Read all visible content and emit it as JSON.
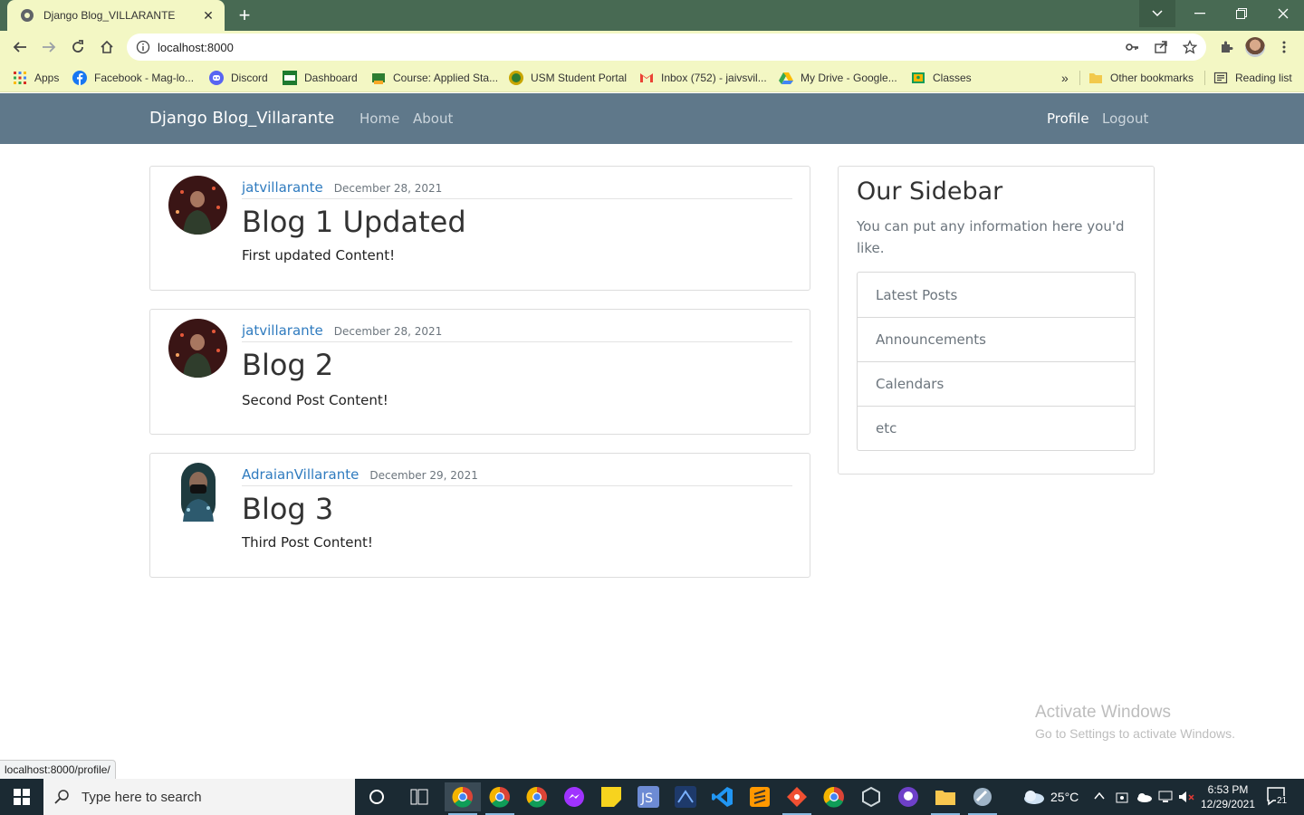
{
  "browser": {
    "tab_title": "Django Blog_VILLARANTE",
    "url": "localhost:8000",
    "status_url": "localhost:8000/profile/"
  },
  "bookmarks": [
    {
      "label": "Apps",
      "icon": "apps-grid-icon"
    },
    {
      "label": "Facebook - Mag-lo...",
      "icon": "facebook-icon"
    },
    {
      "label": "Discord",
      "icon": "discord-icon"
    },
    {
      "label": "Dashboard",
      "icon": "usm-icon"
    },
    {
      "label": "Course: Applied Sta...",
      "icon": "course-icon"
    },
    {
      "label": "USM Student Portal",
      "icon": "usm-portal-icon"
    },
    {
      "label": "Inbox (752) - jaivsvil...",
      "icon": "gmail-icon"
    },
    {
      "label": "My Drive - Google...",
      "icon": "drive-icon"
    },
    {
      "label": "Classes",
      "icon": "classroom-icon"
    }
  ],
  "bookmarks_other": "Other bookmarks",
  "bookmarks_reading": "Reading list",
  "site": {
    "brand": "Django Blog_Villarante",
    "nav_home": "Home",
    "nav_about": "About",
    "nav_profile": "Profile",
    "nav_logout": "Logout"
  },
  "posts": [
    {
      "author": "jatvillarante",
      "date": "December 28, 2021",
      "title": "Blog 1 Updated",
      "content": "First updated Content!"
    },
    {
      "author": "jatvillarante",
      "date": "December 28, 2021",
      "title": "Blog 2",
      "content": "Second Post Content!"
    },
    {
      "author": "AdraianVillarante",
      "date": "December 29, 2021",
      "title": "Blog 3",
      "content": "Third Post Content!"
    }
  ],
  "sidebar": {
    "title": "Our Sidebar",
    "description": "You can put any information here you'd like.",
    "items": [
      "Latest Posts",
      "Announcements",
      "Calendars",
      "etc"
    ]
  },
  "watermark": {
    "line1": "Activate Windows",
    "line2": "Go to Settings to activate Windows."
  },
  "taskbar": {
    "search_placeholder": "Type here to search",
    "temperature": "25°C",
    "time": "6:53 PM",
    "date": "12/29/2021",
    "notification_count": "21"
  }
}
